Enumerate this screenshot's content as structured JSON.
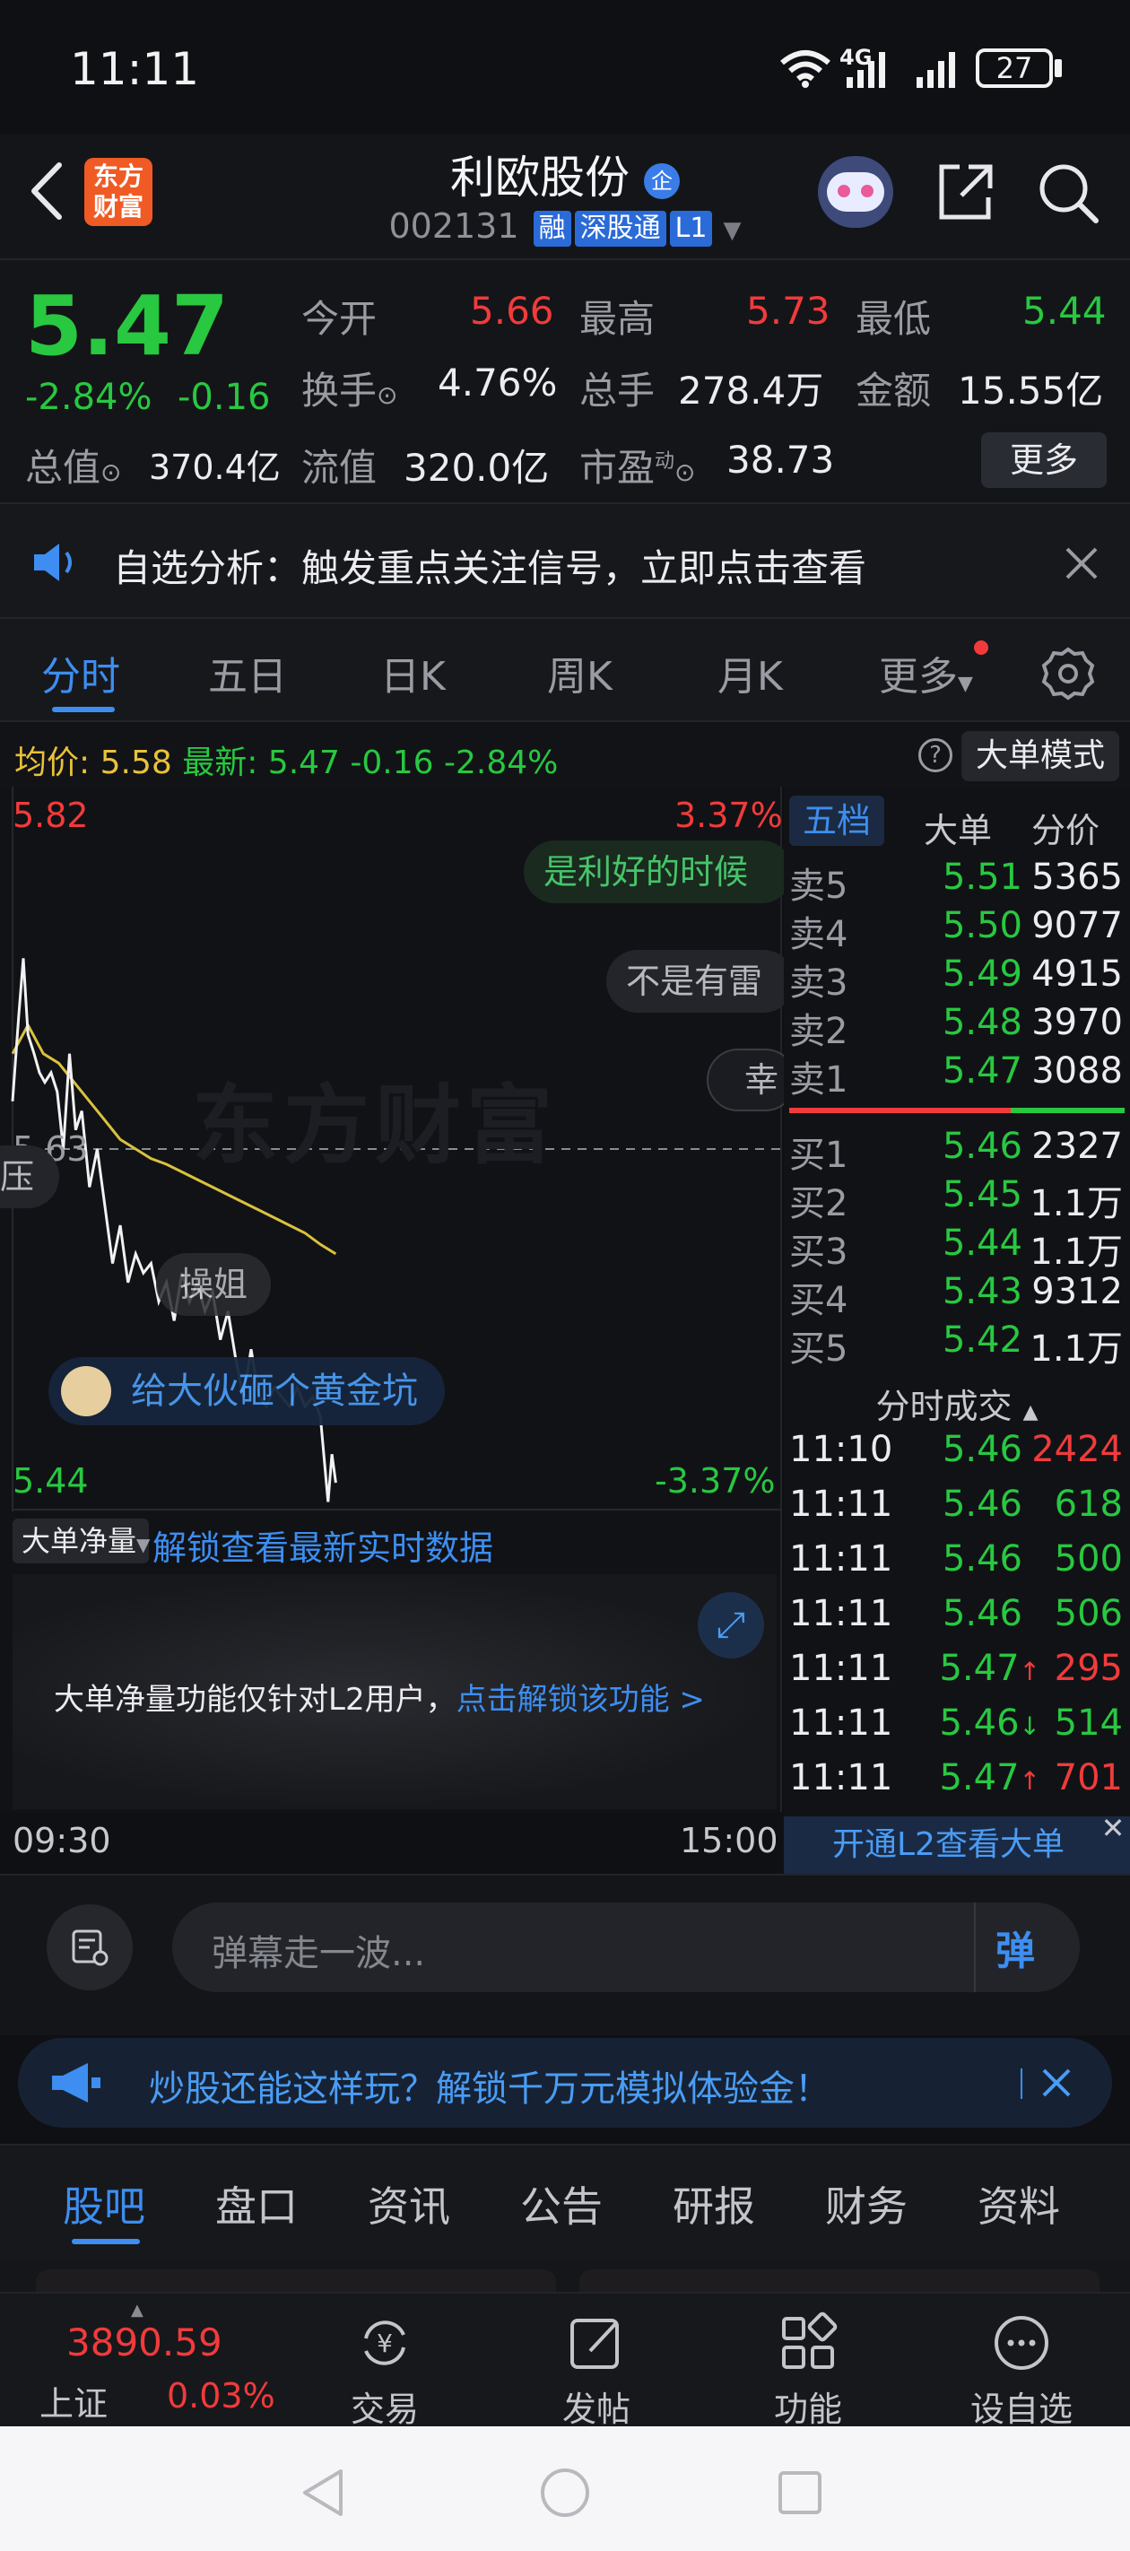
{
  "status_bar": {
    "time": "11:11",
    "network": "4G",
    "battery": "27"
  },
  "header": {
    "logo_text": "东方财富",
    "stock_name": "利欧股份",
    "stock_badge": "企",
    "stock_code": "002131",
    "tags": [
      "融",
      "深股通",
      "L1"
    ]
  },
  "quote": {
    "price": "5.47",
    "change_pct": "-2.84%",
    "change": "-0.16",
    "open_label": "今开",
    "open": "5.66",
    "high_label": "最高",
    "high": "5.73",
    "low_label": "最低",
    "low": "5.44",
    "turnover_label": "换手",
    "turnover": "4.76%",
    "volume_label": "总手",
    "volume": "278.4万",
    "amount_label": "金额",
    "amount": "15.55亿",
    "mcap_label": "总值",
    "mcap": "370.4亿",
    "float_label": "流值",
    "float": "320.0亿",
    "pe_label": "市盈",
    "pe_sup": "动",
    "pe": "38.73",
    "more_button": "更多"
  },
  "notice": {
    "text": "自选分析：触发重点关注信号，立即点击查看"
  },
  "tabs": [
    "分时",
    "五日",
    "日K",
    "周K",
    "月K",
    "更多"
  ],
  "chart_header": {
    "avg_label": "均价:",
    "avg": "5.58",
    "latest_label": "最新:",
    "latest": "5.47",
    "change": "-0.16",
    "change_pct": "-2.84%",
    "mode_button": "大单模式"
  },
  "chart": {
    "y_top": "5.82",
    "y_top_pct": "3.37%",
    "y_mid": "5.63",
    "y_bottom": "5.44",
    "y_bottom_pct": "-3.37%",
    "x_start": "09:30",
    "x_end": "15:00",
    "watermark": "东方财富",
    "danmu": [
      "是利好的时候",
      "不是有雷",
      "幸",
      "压",
      "操姐",
      "给大伙砸个黄金坑"
    ]
  },
  "big_order": {
    "select_label": "大单净量",
    "unlock_link": "解锁查看最新实时数据",
    "info_text": "大单净量功能仅针对L2用户，",
    "info_link": "点击解锁该功能 >"
  },
  "orderbook": {
    "tabs": [
      "五档",
      "大单",
      "分价"
    ],
    "asks": [
      {
        "label": "卖5",
        "price": "5.51",
        "vol": "5365"
      },
      {
        "label": "卖4",
        "price": "5.50",
        "vol": "9077"
      },
      {
        "label": "卖3",
        "price": "5.49",
        "vol": "4915"
      },
      {
        "label": "卖2",
        "price": "5.48",
        "vol": "3970"
      },
      {
        "label": "卖1",
        "price": "5.47",
        "vol": "3088"
      }
    ],
    "bids": [
      {
        "label": "买1",
        "price": "5.46",
        "vol": "2327"
      },
      {
        "label": "买2",
        "price": "5.45",
        "vol": "1.1万"
      },
      {
        "label": "买3",
        "price": "5.44",
        "vol": "1.1万"
      },
      {
        "label": "买4",
        "price": "5.43",
        "vol": "9312"
      },
      {
        "label": "买5",
        "price": "5.42",
        "vol": "1.1万"
      }
    ],
    "ticks_title": "分时成交",
    "ticks": [
      {
        "time": "11:10",
        "price": "5.46",
        "vol": "2424",
        "arrow": ""
      },
      {
        "time": "11:11",
        "price": "5.46",
        "vol": "618",
        "arrow": ""
      },
      {
        "time": "11:11",
        "price": "5.46",
        "vol": "500",
        "arrow": ""
      },
      {
        "time": "11:11",
        "price": "5.46",
        "vol": "506",
        "arrow": ""
      },
      {
        "time": "11:11",
        "price": "5.47",
        "vol": "295",
        "arrow": "↑"
      },
      {
        "time": "11:11",
        "price": "5.46",
        "vol": "514",
        "arrow": "↓"
      },
      {
        "time": "11:11",
        "price": "5.47",
        "vol": "701",
        "arrow": "↑"
      }
    ],
    "l2_link": "开通L2查看大单"
  },
  "danmu_input": {
    "placeholder": "弹幕走一波...",
    "send_label": "弹"
  },
  "promo": {
    "text": "炒股还能这样玩？解锁千万元模拟体验金！"
  },
  "bottom_tabs": [
    "股吧",
    "盘口",
    "资讯",
    "公告",
    "研报",
    "财务",
    "资料"
  ],
  "bottom_nav": {
    "index_value": "3890.59",
    "index_name": "上证",
    "index_pct": "0.03%",
    "items": [
      "交易",
      "发帖",
      "功能",
      "设自选"
    ]
  },
  "colors": {
    "up": "#f13b3b",
    "down": "#28c840",
    "accent": "#3d8ef0",
    "avg_line": "#e8c23a"
  }
}
